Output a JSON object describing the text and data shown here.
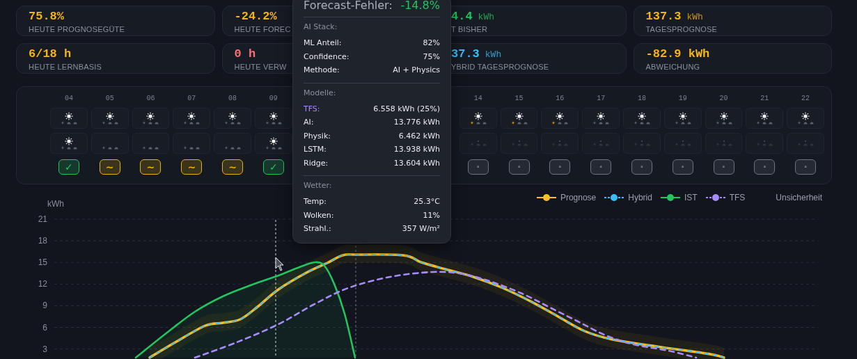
{
  "stats": [
    {
      "value": "75.8%",
      "label": "HEUTE PROGNOSEGÜTE",
      "color": "#f5b417",
      "covered": false
    },
    {
      "value": "-24.2%",
      "label": "HEUTE FOREC",
      "color": "#f5b417",
      "covered": false
    },
    {
      "value": "4.4",
      "unit": "kWh",
      "label": "T BISHER",
      "color": "#22c55e",
      "covered": true
    },
    {
      "value": "137.3",
      "unit": "kWh",
      "label": "TAGESPROGNOSE",
      "color": "#f5b417",
      "covered": false
    },
    {
      "value": "6/18 h",
      "label": "HEUTE LERNBASIS",
      "color": "#f5b417",
      "covered": false
    },
    {
      "value": "0 h",
      "label": "HEUTE VERW",
      "color": "#f87171",
      "covered": false
    },
    {
      "value": "37.3",
      "unit": "kWh",
      "label": "YBRID TAGESPROGNOSE",
      "color": "#38bdf8",
      "covered": true
    },
    {
      "value": "-82.9 kWh",
      "label": "ABWEICHUNG",
      "color": "#f5b417",
      "covered": false
    }
  ],
  "hours": [
    {
      "kind": "hour",
      "label": "04",
      "sun_active": false,
      "actual_sun": true,
      "pending": false,
      "symbol": "✓",
      "color": "#22c55e"
    },
    {
      "kind": "hour",
      "label": "05",
      "sun_active": false,
      "actual_sun": false,
      "pending": false,
      "symbol": "~",
      "color": "#eab308"
    },
    {
      "kind": "hour",
      "label": "06",
      "sun_active": false,
      "actual_sun": false,
      "pending": false,
      "symbol": "~",
      "color": "#eab308"
    },
    {
      "kind": "hour",
      "label": "07",
      "sun_active": false,
      "actual_sun": false,
      "pending": false,
      "symbol": "~",
      "color": "#eab308"
    },
    {
      "kind": "hour",
      "label": "08",
      "sun_active": false,
      "actual_sun": false,
      "pending": false,
      "symbol": "~",
      "color": "#eab308"
    },
    {
      "kind": "hour",
      "label": "09",
      "sun_active": false,
      "actual_sun": true,
      "pending": false,
      "symbol": "✓",
      "color": "#22c55e"
    },
    {
      "kind": "covered"
    },
    {
      "kind": "covered"
    },
    {
      "kind": "covered"
    },
    {
      "kind": "covered"
    },
    {
      "kind": "hour",
      "label": "14",
      "sun_active": true,
      "actual_sun": false,
      "pending": true,
      "symbol": "·",
      "color": "#6b7280"
    },
    {
      "kind": "hour",
      "label": "15",
      "sun_active": true,
      "actual_sun": false,
      "pending": true,
      "symbol": "·",
      "color": "#6b7280"
    },
    {
      "kind": "hour",
      "label": "16",
      "sun_active": true,
      "actual_sun": false,
      "pending": true,
      "symbol": "·",
      "color": "#6b7280"
    },
    {
      "kind": "hour",
      "label": "17",
      "sun_active": false,
      "actual_sun": false,
      "pending": true,
      "symbol": "·",
      "color": "#6b7280"
    },
    {
      "kind": "hour",
      "label": "18",
      "sun_active": false,
      "actual_sun": false,
      "pending": true,
      "symbol": "·",
      "color": "#6b7280"
    },
    {
      "kind": "hour",
      "label": "19",
      "sun_active": false,
      "actual_sun": false,
      "pending": true,
      "symbol": "·",
      "color": "#6b7280"
    },
    {
      "kind": "hour",
      "label": "20",
      "sun_active": false,
      "actual_sun": false,
      "pending": true,
      "symbol": "·",
      "color": "#6b7280"
    },
    {
      "kind": "hour",
      "label": "21",
      "sun_active": false,
      "actual_sun": false,
      "pending": true,
      "symbol": "·",
      "color": "#6b7280"
    },
    {
      "kind": "hour",
      "label": "22",
      "sun_active": false,
      "actual_sun": false,
      "pending": true,
      "symbol": "·",
      "color": "#6b7280"
    }
  ],
  "chart": {
    "unit": "kWh",
    "y_tick_labels": [
      "21",
      "18",
      "15",
      "12",
      "9",
      "6",
      "3"
    ],
    "legend": [
      {
        "kind": "series",
        "label": "Prognose",
        "color": "#fbbf24",
        "dashed": false
      },
      {
        "kind": "series",
        "label": "Hybrid",
        "color": "#38bdf8",
        "dashed": true
      },
      {
        "kind": "series",
        "label": "IST",
        "color": "#22c55e",
        "dashed": false
      },
      {
        "kind": "series",
        "label": "TFS",
        "color": "#a78bfa",
        "dashed": true
      },
      {
        "kind": "plain",
        "label": "Unsicherheit"
      }
    ]
  },
  "tooltip": {
    "title": "Forecast-Fehler:",
    "title_value": "-14.8%",
    "sections": [
      {
        "heading": "AI Stack:",
        "rows": [
          {
            "label": "ML Anteil:",
            "value": "82%",
            "accent": false
          },
          {
            "label": "Confidence:",
            "value": "75%",
            "accent": false
          },
          {
            "label": "Methode:",
            "value": "AI + Physics",
            "accent": false
          }
        ]
      },
      {
        "heading": "Modelle:",
        "rows": [
          {
            "label": "TFS:",
            "value": "6.558 kWh (25%)",
            "accent": true
          },
          {
            "label": "AI:",
            "value": "13.776 kWh",
            "accent": false
          },
          {
            "label": "Physik:",
            "value": "6.462 kWh",
            "accent": false
          },
          {
            "label": "LSTM:",
            "value": "13.938 kWh",
            "accent": false
          },
          {
            "label": "Ridge:",
            "value": "13.604 kWh",
            "accent": false
          }
        ]
      },
      {
        "heading": "Wetter:",
        "rows": [
          {
            "label": "Temp:",
            "value": "25.3°C",
            "accent": false
          },
          {
            "label": "Wolken:",
            "value": "11%",
            "accent": false
          },
          {
            "label": "Strahl.:",
            "value": "357 W/m²",
            "accent": false
          }
        ]
      }
    ]
  }
}
